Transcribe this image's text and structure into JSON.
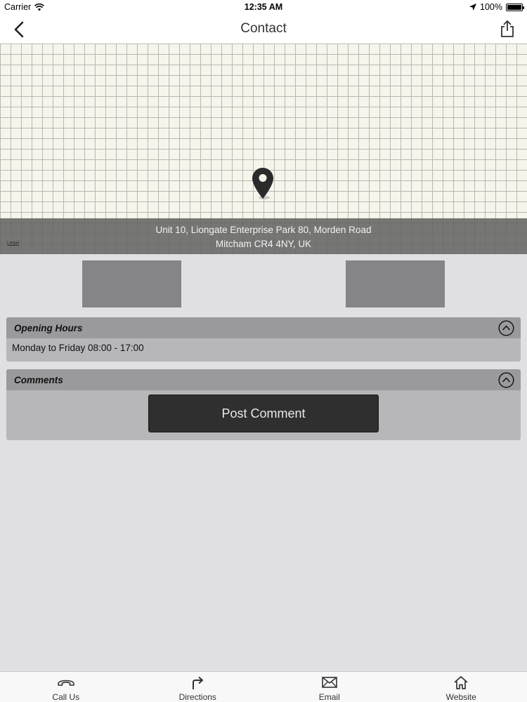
{
  "status_bar": {
    "carrier": "Carrier",
    "time": "12:35 AM",
    "battery": "100%",
    "battery_level": 1.0
  },
  "nav": {
    "title": "Contact",
    "back_icon": "chevron-left-icon",
    "share_icon": "share-icon"
  },
  "map": {
    "pin_icon": "map-pin-icon",
    "address_line1": "Unit 10, Liongate Enterprise Park 80, Morden Road",
    "address_line2": "Mitcham CR4 4NY, UK",
    "legal": "Legal"
  },
  "opening_hours": {
    "title": "Opening Hours",
    "text": "Monday to Friday 08:00 - 17:00",
    "toggle_icon": "chevron-up-circle-icon"
  },
  "comments": {
    "title": "Comments",
    "button": "Post Comment",
    "toggle_icon": "chevron-up-circle-icon"
  },
  "tabs": [
    {
      "label": "Call Us",
      "icon": "phone-icon"
    },
    {
      "label": "Directions",
      "icon": "directions-arrow-icon"
    },
    {
      "label": "Email",
      "icon": "envelope-icon"
    },
    {
      "label": "Website",
      "icon": "home-icon"
    }
  ],
  "colors": {
    "background": "#e0dfe2",
    "panel": "#b7b6b9",
    "panel_header": "#9a999c",
    "button": "#2f2f2f",
    "placeholder": "#858487"
  }
}
